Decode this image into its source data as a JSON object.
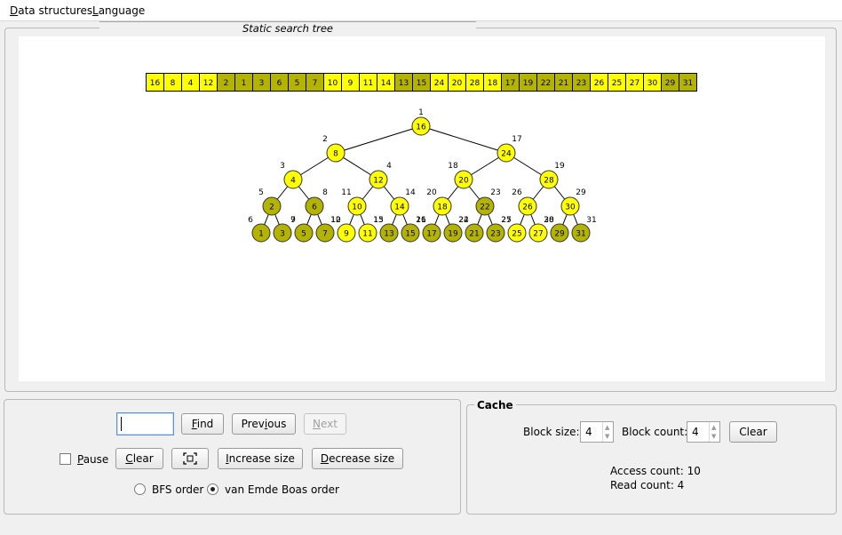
{
  "menu": {
    "data_structures": {
      "first": "D",
      "rest": "ata structures"
    },
    "language": {
      "first": "L",
      "rest": "anguage"
    }
  },
  "tree_panel": {
    "title": "Static search tree",
    "array": [
      16,
      8,
      4,
      12,
      2,
      1,
      3,
      6,
      5,
      7,
      10,
      9,
      11,
      14,
      13,
      15,
      24,
      20,
      28,
      18,
      17,
      19,
      22,
      21,
      23,
      26,
      25,
      27,
      30,
      29,
      31
    ],
    "array_dark": [
      2,
      1,
      3,
      6,
      5,
      7,
      13,
      15,
      17,
      19,
      21,
      22,
      23,
      29,
      31
    ],
    "nodes": [
      {
        "value": 16,
        "index": 1,
        "level": 0,
        "pos": 0,
        "dark": false
      },
      {
        "value": 8,
        "index": 2,
        "level": 1,
        "pos": 0,
        "dark": false
      },
      {
        "value": 24,
        "index": 17,
        "level": 1,
        "pos": 1,
        "dark": false
      },
      {
        "value": 4,
        "index": 3,
        "level": 2,
        "pos": 0,
        "dark": false
      },
      {
        "value": 12,
        "index": 4,
        "level": 2,
        "pos": 1,
        "dark": false
      },
      {
        "value": 20,
        "index": 18,
        "level": 2,
        "pos": 2,
        "dark": false
      },
      {
        "value": 28,
        "index": 19,
        "level": 2,
        "pos": 3,
        "dark": false
      },
      {
        "value": 2,
        "index": 5,
        "level": 3,
        "pos": 0,
        "dark": true
      },
      {
        "value": 6,
        "index": 8,
        "level": 3,
        "pos": 1,
        "dark": true
      },
      {
        "value": 10,
        "index": 11,
        "level": 3,
        "pos": 2,
        "dark": false
      },
      {
        "value": 14,
        "index": 14,
        "level": 3,
        "pos": 3,
        "dark": false
      },
      {
        "value": 18,
        "index": 20,
        "level": 3,
        "pos": 4,
        "dark": false
      },
      {
        "value": 22,
        "index": 23,
        "level": 3,
        "pos": 5,
        "dark": true
      },
      {
        "value": 26,
        "index": 26,
        "level": 3,
        "pos": 6,
        "dark": false
      },
      {
        "value": 30,
        "index": 29,
        "level": 3,
        "pos": 7,
        "dark": false
      },
      {
        "value": 1,
        "index": 6,
        "level": 4,
        "pos": 0,
        "dark": true
      },
      {
        "value": 3,
        "index": 7,
        "level": 4,
        "pos": 1,
        "dark": true
      },
      {
        "value": 5,
        "index": 9,
        "level": 4,
        "pos": 2,
        "dark": true
      },
      {
        "value": 7,
        "index": 10,
        "level": 4,
        "pos": 3,
        "dark": true
      },
      {
        "value": 9,
        "index": 12,
        "level": 4,
        "pos": 4,
        "dark": false
      },
      {
        "value": 11,
        "index": 13,
        "level": 4,
        "pos": 5,
        "dark": false
      },
      {
        "value": 13,
        "index": 15,
        "level": 4,
        "pos": 6,
        "dark": true
      },
      {
        "value": 15,
        "index": 16,
        "level": 4,
        "pos": 7,
        "dark": true
      },
      {
        "value": 17,
        "index": 21,
        "level": 4,
        "pos": 8,
        "dark": true
      },
      {
        "value": 19,
        "index": 22,
        "level": 4,
        "pos": 9,
        "dark": true
      },
      {
        "value": 21,
        "index": 24,
        "level": 4,
        "pos": 10,
        "dark": true
      },
      {
        "value": 23,
        "index": 25,
        "level": 4,
        "pos": 11,
        "dark": true
      },
      {
        "value": 25,
        "index": 27,
        "level": 4,
        "pos": 12,
        "dark": false
      },
      {
        "value": 27,
        "index": 28,
        "level": 4,
        "pos": 13,
        "dark": false
      },
      {
        "value": 29,
        "index": 30,
        "level": 4,
        "pos": 14,
        "dark": true
      },
      {
        "value": 31,
        "index": 31,
        "level": 4,
        "pos": 15,
        "dark": true
      }
    ],
    "colors": {
      "yellow": "#ffff00",
      "dark": "#b4b400",
      "stroke": "#333333"
    }
  },
  "controls": {
    "search_value": "",
    "find": {
      "first": "F",
      "rest": "ind"
    },
    "previous": {
      "pre": "Prev",
      "u": "i",
      "post": "ous"
    },
    "next": {
      "first": "N",
      "rest": "ext"
    },
    "pause": {
      "first": "P",
      "rest": "ause"
    },
    "clear": {
      "first": "C",
      "rest": "lear"
    },
    "increase": {
      "first": "I",
      "rest": "ncrease size"
    },
    "decrease": {
      "first": "D",
      "rest": "ecrease size"
    },
    "bfs_label": "BFS order",
    "veb_label": "van Emde Boas order"
  },
  "cache": {
    "title": "Cache",
    "block_size_label": "Block size:",
    "block_size": "4",
    "block_count_label": "Block count:",
    "block_count": "4",
    "clear_label": "Clear",
    "access_count": "Access count: 10",
    "read_count": "Read count: 4"
  }
}
